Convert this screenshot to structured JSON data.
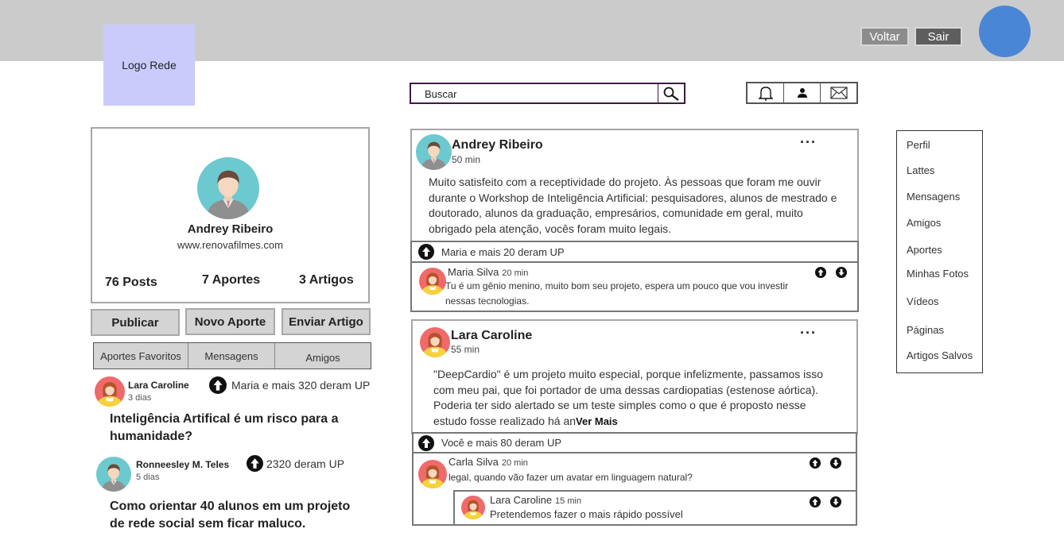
{
  "header": {
    "logo_label": "Logo Rede",
    "voltar_label": "Voltar",
    "sair_label": "Sair",
    "colors": {
      "bar": "#cbcbcb",
      "logo": "#cacbfb",
      "avatar": "#4a86d6"
    }
  },
  "search": {
    "placeholder": "Buscar"
  },
  "icons": {
    "search": "search-icon",
    "notifications": "bell-icon",
    "profile": "user-icon",
    "messages": "envelope-icon"
  },
  "profile": {
    "name": "Andrey Ribeiro",
    "url": "www.renovafilmes.com",
    "stats": {
      "posts": "76 Posts",
      "aportes": "7 Aportes",
      "artigos": "3 Artigos"
    }
  },
  "actions": {
    "publicar": "Publicar",
    "novo_aporte": "Novo Aporte",
    "enviar_artigo": "Enviar Artigo"
  },
  "tabs": [
    "Aportes Favoritos",
    "Mensagens",
    "Amigos"
  ],
  "feed_left": [
    {
      "author": "Lara Caroline",
      "time": "3 dias",
      "ups": "Maria e mais 320 deram UP",
      "title": "Inteligência Artifical é um risco para a humanidade?"
    },
    {
      "author": "Ronneesley M. Teles",
      "time": "5 dias",
      "ups": "2320 deram UP",
      "title": "Como orientar 40 alunos em um projeto de rede social sem ficar maluco."
    }
  ],
  "posts": [
    {
      "author": "Andrey Ribeiro",
      "time": "50 min",
      "more": "···",
      "text": "Muito satisfeito com a receptividade do projeto. Às pessoas que foram me ouvir durante o Workshop de Inteligência Artificial: pesquisadores, alunos de mestrado e doutorado, alunos da graduação, empresários, comunidade em geral, muito obrigado pela atenção, vocês foram muito legais.",
      "ups": "Maria e mais 20 deram UP",
      "comments": [
        {
          "author": "Maria Silva",
          "time": "20 min",
          "text": "Tu é um gênio menino, muito bom seu projeto, espera um pouco que vou investir nessas tecnologias."
        }
      ]
    },
    {
      "author": "Lara Caroline",
      "time": "55 min",
      "more": "···",
      "text": "\"DeepCardio\" é um projeto muito especial, porque infelizmente, passamos isso com meu pai, que foi portador de uma dessas cardiopatias (estenose aórtica). Poderia ter sido alertado se um teste simples como o que é proposto nesse estudo fosse realizado há an",
      "read_more": "Ver Mais",
      "ups": "Você e mais 80 deram UP",
      "comments": [
        {
          "author": "Carla Silva",
          "time": "20 min",
          "text": "legal, quando vão fazer um avatar em linguagem natural?"
        },
        {
          "author": "Lara Caroline",
          "time": "15 min",
          "text": "Pretendemos fazer o mais rápido possível"
        }
      ]
    }
  ],
  "right_menu": [
    "Perfil",
    "Lattes",
    "Mensagens",
    "Amigos",
    "Aportes",
    "Minhas Fotos",
    "Vídeos",
    "Páginas",
    "Artigos Salvos"
  ]
}
